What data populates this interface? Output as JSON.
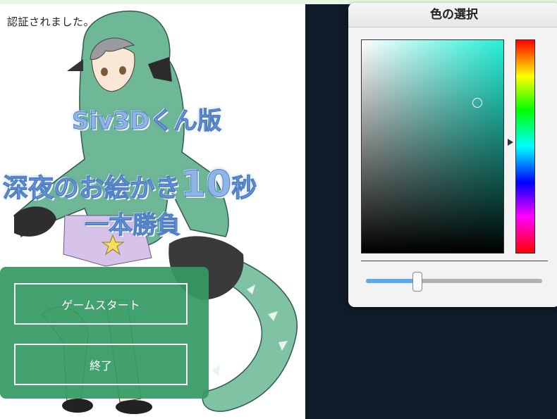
{
  "status": {
    "auth_message": "認証されました。"
  },
  "title": {
    "line1": "Siv3Dくん版",
    "line2_a": "深夜のお絵かき",
    "line2_b": "10",
    "line2_c": "秒",
    "line3": "一本勝負"
  },
  "menu": {
    "start_label": "ゲームスタート",
    "quit_label": "終了"
  },
  "color_picker": {
    "title": "色の選択",
    "current_hue_color": "#24f0d6",
    "alpha_slider_value": 0.29
  },
  "colors": {
    "menu_panel": "#349a63",
    "dark_background": "#0f1b28",
    "slider_fill": "#5aa9ee",
    "title_text": "#8fb4e6"
  }
}
